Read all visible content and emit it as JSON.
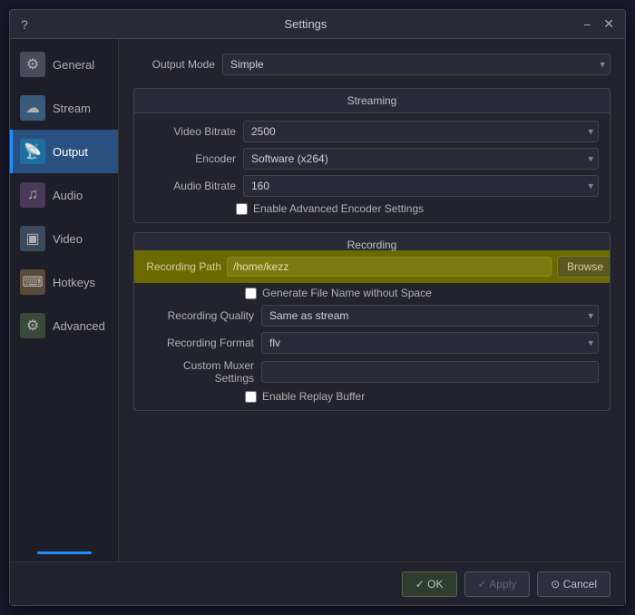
{
  "titlebar": {
    "title": "Settings",
    "help_icon": "?",
    "minimize_icon": "−",
    "close_icon": "✕"
  },
  "sidebar": {
    "items": [
      {
        "id": "general",
        "label": "General",
        "icon": "⚙"
      },
      {
        "id": "stream",
        "label": "Stream",
        "icon": "☁"
      },
      {
        "id": "output",
        "label": "Output",
        "icon": "📡"
      },
      {
        "id": "audio",
        "label": "Audio",
        "icon": "🎵"
      },
      {
        "id": "video",
        "label": "Video",
        "icon": "🖥"
      },
      {
        "id": "hotkeys",
        "label": "Hotkeys",
        "icon": "⌨"
      },
      {
        "id": "advanced",
        "label": "Advanced",
        "icon": "⚙"
      }
    ],
    "active": "output"
  },
  "content": {
    "output_mode_label": "Output Mode",
    "output_mode_value": "Simple",
    "streaming_section_title": "Streaming",
    "video_bitrate_label": "Video Bitrate",
    "video_bitrate_value": "2500",
    "encoder_label": "Encoder",
    "encoder_value": "Software (x264)",
    "audio_bitrate_label": "Audio Bitrate",
    "audio_bitrate_value": "160",
    "enable_advanced_label": "Enable Advanced Encoder Settings",
    "recording_section_title": "Recording",
    "recording_path_label": "Recording Path",
    "recording_path_value": "/home/kezz",
    "browse_label": "Browse",
    "generate_filename_label": "Generate File Name without Space",
    "recording_quality_label": "Recording Quality",
    "recording_quality_value": "Same as stream",
    "recording_format_label": "Recording Format",
    "recording_format_value": "flv",
    "custom_muxer_label": "Custom Muxer Settings",
    "custom_muxer_value": "",
    "enable_replay_label": "Enable Replay Buffer"
  },
  "footer": {
    "ok_label": "✓ OK",
    "apply_label": "✓ Apply",
    "cancel_label": "⊙ Cancel"
  }
}
